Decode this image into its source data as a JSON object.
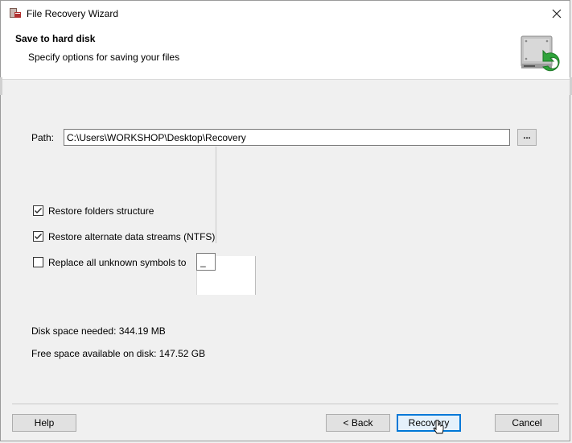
{
  "window": {
    "title": "File Recovery Wizard"
  },
  "header": {
    "title": "Save to hard disk",
    "subtitle": "Specify options for saving your files"
  },
  "path": {
    "label": "Path:",
    "value": "C:\\Users\\WORKSHOP\\Desktop\\Recovery",
    "browse_label": "..."
  },
  "options": {
    "restore_folders": {
      "label": "Restore folders structure",
      "checked": true
    },
    "restore_streams": {
      "label": "Restore alternate data streams (NTFS)",
      "checked": true
    },
    "replace_symbols": {
      "label": "Replace all unknown symbols to",
      "checked": false,
      "symbol": "_"
    }
  },
  "disk": {
    "needed": "Disk space needed: 344.19 MB",
    "free": "Free space available on disk: 147.52 GB"
  },
  "buttons": {
    "help": "Help",
    "back": "< Back",
    "recovery": "Recovery",
    "cancel": "Cancel"
  },
  "colors": {
    "accent": "#0078d7",
    "icon_green": "#2fa33b"
  }
}
